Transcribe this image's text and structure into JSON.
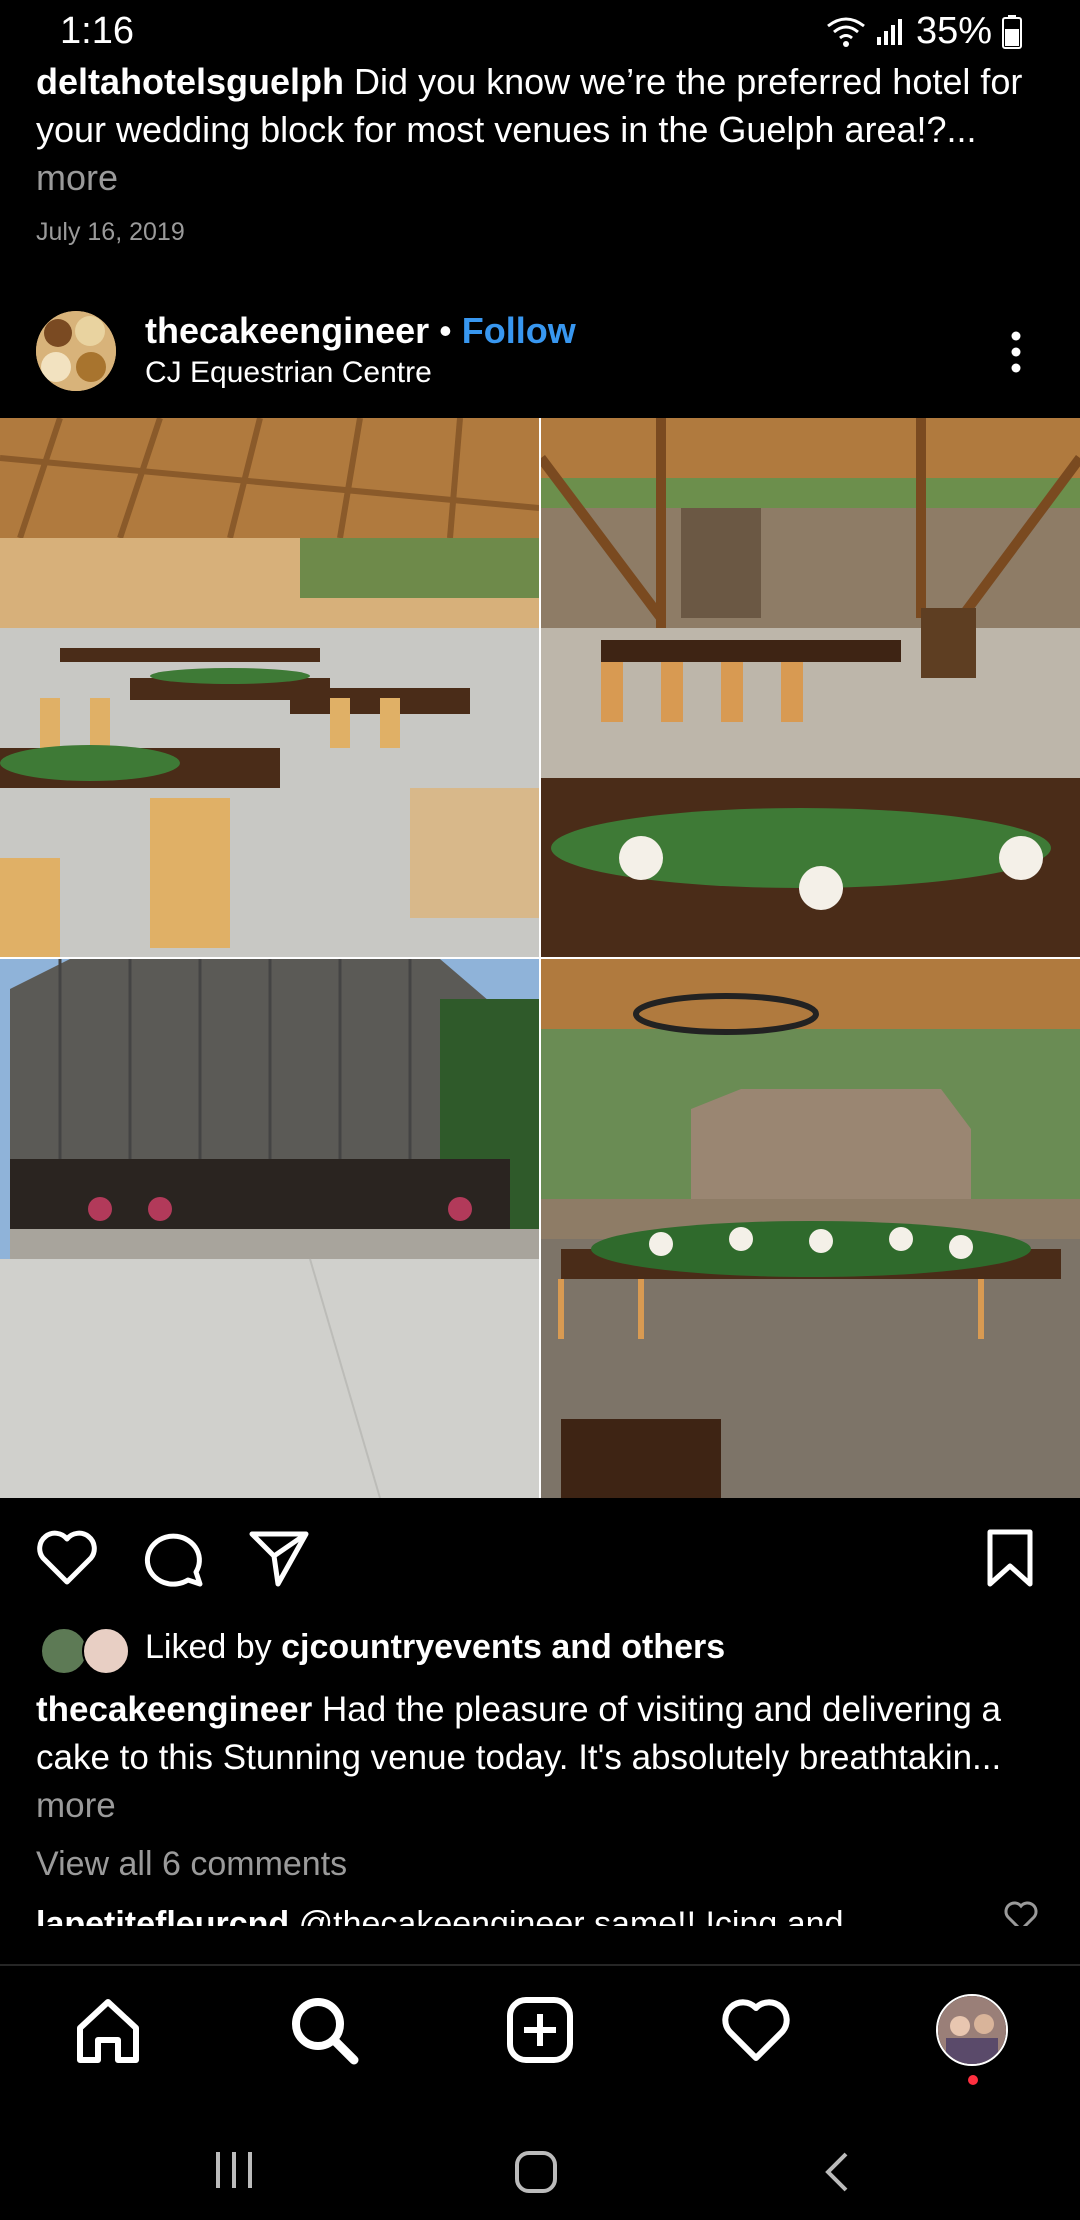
{
  "status_bar": {
    "time": "1:16",
    "battery": "35%"
  },
  "previous_post": {
    "username": "deltahotelsguelph",
    "caption": "Did you know we’re the preferred hotel for your wedding block for most venues in the Guelph area!?...",
    "more": "more",
    "date": "July 16, 2019"
  },
  "post": {
    "username": "thecakeengineer",
    "separator": "•",
    "follow_label": "Follow",
    "location": "CJ Equestrian Centre",
    "liked_prefix": "Liked by",
    "liked_user": "cjcountryevents",
    "liked_suffix": "and others",
    "caption_user": "thecakeengineer",
    "caption": "Had the pleasure of visiting and delivering a cake to this Stunning venue today. It's absolutely breathtakin...",
    "more": "more",
    "view_comments": "View all 6 comments",
    "comment_user": "lapetitefleurcnd",
    "comment_text": "@thecakeengineer same!! Icing and"
  },
  "icons": {
    "actions": [
      "heart-icon",
      "comment-icon",
      "share-icon",
      "bookmark-icon"
    ],
    "nav": [
      "home-icon",
      "search-icon",
      "add-post-icon",
      "activity-heart-icon",
      "profile-avatar"
    ],
    "system": [
      "recent-apps-icon",
      "home-button-icon",
      "back-icon"
    ]
  },
  "colors": {
    "accent": "#3897f0",
    "muted": "#9a9a9a",
    "notification": "#ff3040"
  }
}
